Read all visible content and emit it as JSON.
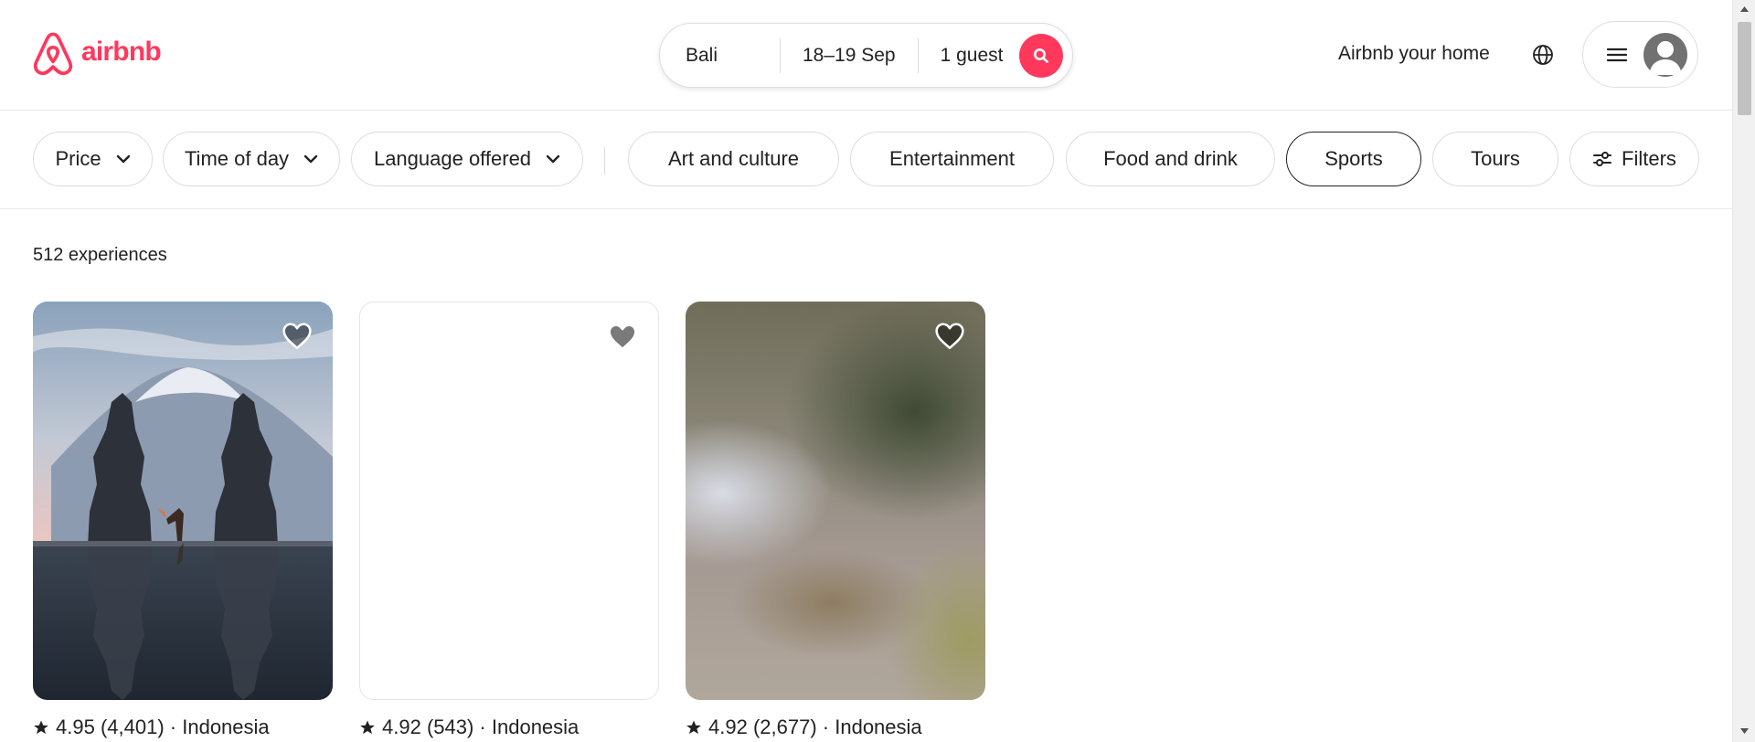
{
  "header": {
    "logo_text": "airbnb",
    "brand_color": "#ff385c",
    "search": {
      "location": "Bali",
      "dates": "18–19 Sep",
      "guests": "1 guest"
    },
    "host_link": "Airbnb your home"
  },
  "filters": {
    "dropdowns": [
      {
        "label": "Price"
      },
      {
        "label": "Time of day"
      },
      {
        "label": "Language offered"
      }
    ],
    "categories": [
      {
        "label": "Art and culture",
        "selected": false
      },
      {
        "label": "Entertainment",
        "selected": false
      },
      {
        "label": "Food and drink",
        "selected": false
      },
      {
        "label": "Sports",
        "selected": true
      },
      {
        "label": "Tours",
        "selected": false
      }
    ],
    "filters_label": "Filters"
  },
  "results": {
    "count": "512 experiences",
    "cards": [
      {
        "rating": "4.95",
        "reviews": "(4,401)",
        "location": "Indonesia"
      },
      {
        "rating": "4.92",
        "reviews": "(543)",
        "location": "Indonesia"
      },
      {
        "rating": "4.92",
        "reviews": "(2,677)",
        "location": "Indonesia"
      }
    ]
  }
}
